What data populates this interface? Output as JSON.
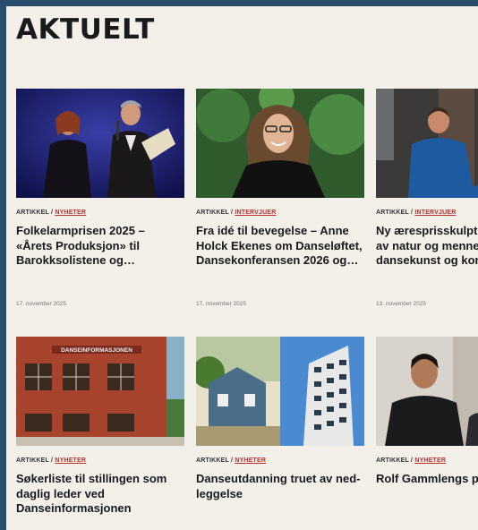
{
  "section": {
    "title": "AKTUELT"
  },
  "cards": [
    {
      "type": "ARTIKKEL",
      "sep": " / ",
      "category": "NYHETER",
      "headline": "Folkelarmprisen 2025 –\n«Årets Produksjon» til\nBarokksolistene og…",
      "date": "17. november 2025"
    },
    {
      "type": "ARTIKKEL",
      "sep": " / ",
      "category": "INTERVJUER",
      "headline": "Fra idé til bevegelse – Anne\nHolck Ekenes om Danseløftet,\nDansekonferansen 2026 og…",
      "date": "17. november 2025"
    },
    {
      "type": "ARTIKKEL",
      "sep": " / ",
      "category": "INTERVJUER",
      "headline": "Ny æresprisskulpt\nav natur og menne\ndansekunst og kor",
      "date": "13. november 2025"
    },
    {
      "type": "ARTIKKEL",
      "sep": " / ",
      "category": "NYHETER",
      "headline": "Søkerliste til stillingen som\ndaglig leder ved\nDanseinformasjonen"
    },
    {
      "type": "ARTIKKEL",
      "sep": " / ",
      "category": "NYHETER",
      "headline": "Danseutdanning truet av ned-\nleggelse"
    },
    {
      "type": "ARTIKKEL",
      "sep": " / ",
      "category": "NYHETER",
      "headline": "Rolf Gammlengs p"
    }
  ],
  "photo": {
    "building_sign": "DANSEINFORMASJONEN"
  },
  "colors": {
    "frame": "#2a4c6b",
    "background": "#f2f0e9",
    "accent": "#b8312f"
  }
}
